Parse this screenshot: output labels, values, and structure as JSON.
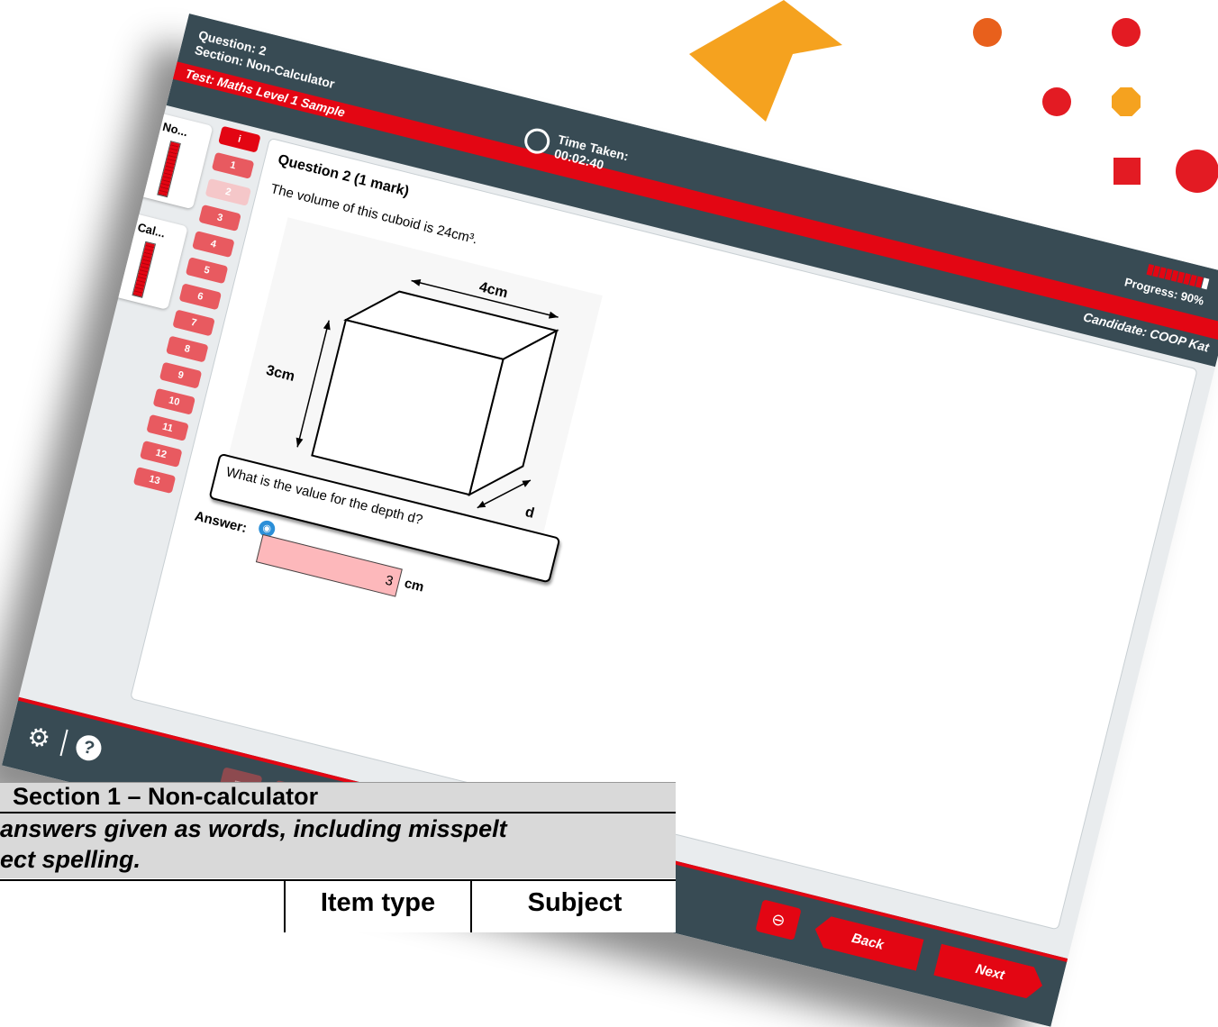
{
  "header": {
    "question": "Question: 2",
    "section": "Section: Non-Calculator",
    "test": "Test: Maths Level 1 Sample",
    "time_label": "Time Taken:",
    "time_value": "00:02:40",
    "progress_label": "Progress: 90%",
    "progress_fraction": 0.9,
    "candidate": "Candidate: COOP Kat"
  },
  "side_tabs": [
    {
      "label": "No..."
    },
    {
      "label": "Cal..."
    }
  ],
  "question_nav": [
    "1",
    "2",
    "3",
    "4",
    "5",
    "6",
    "7",
    "8",
    "9",
    "10",
    "11",
    "12",
    "13"
  ],
  "question": {
    "title": "Question 2 (1 mark)",
    "text": "The volume of this cuboid is 24cm³.",
    "dim_width": "4cm",
    "dim_height": "3cm",
    "dim_depth": "d",
    "prompt": "What is the value for the depth d?",
    "answer_label": "Answer:",
    "answer_value": "3",
    "answer_unit": "cm"
  },
  "footer": {
    "back_label": "Back",
    "next_label": "Next"
  },
  "document": {
    "heading": "Section 1 – Non-calculator",
    "note_line1": "answers given as words, including misspelt",
    "note_line2": "ect spelling.",
    "col_item_type": "Item type",
    "col_subject": "Subject"
  },
  "colors": {
    "accent_red": "#e30613",
    "header_slate": "#384b54",
    "arrow_orange": "#f5a21f"
  }
}
